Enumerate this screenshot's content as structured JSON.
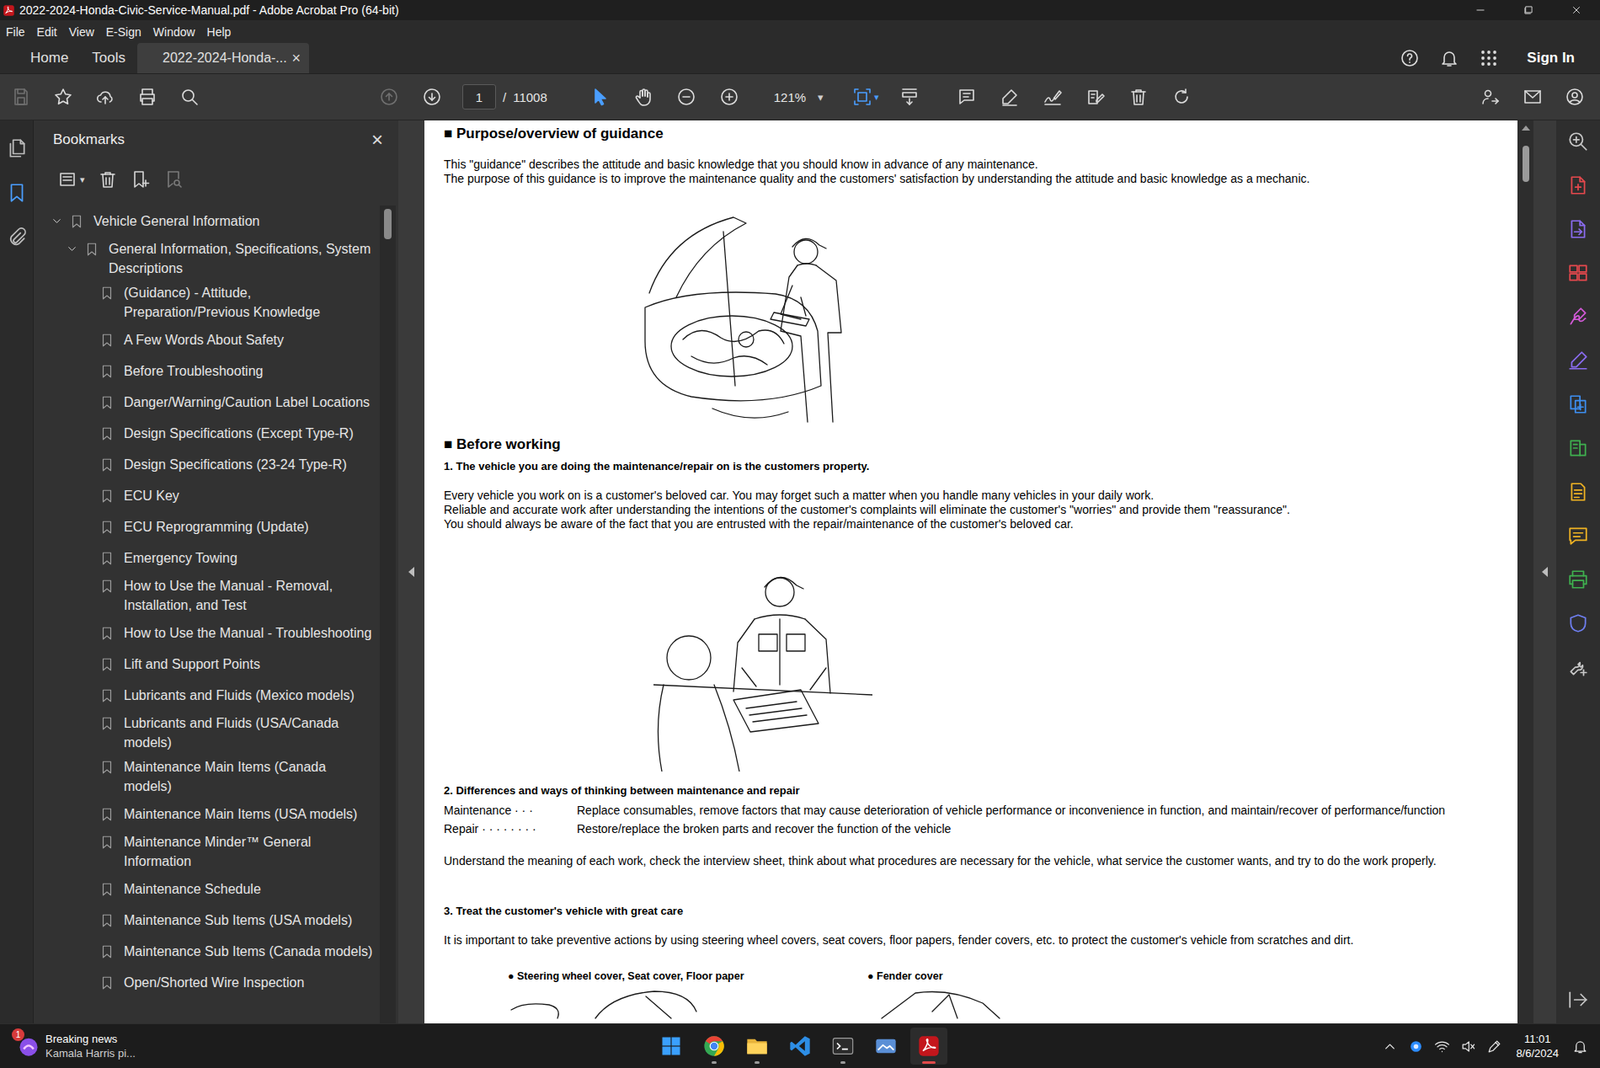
{
  "window": {
    "title": "2022-2024-Honda-Civic-Service-Manual.pdf - Adobe Acrobat Pro (64-bit)",
    "controls": [
      {
        "kind": "minimize"
      },
      {
        "kind": "restore"
      },
      {
        "kind": "close"
      }
    ]
  },
  "menu": [
    "File",
    "Edit",
    "View",
    "E-Sign",
    "Window",
    "Help"
  ],
  "tabs": [
    {
      "label": "Home",
      "selected": false
    },
    {
      "label": "Tools",
      "selected": false
    },
    {
      "label": "2022-2024-Honda-...",
      "selected": true,
      "close": "×"
    }
  ],
  "header_actions": [
    {
      "kind": "help"
    },
    {
      "kind": "bell"
    },
    {
      "kind": "apps"
    }
  ],
  "sign_in": "Sign In",
  "toolbar": {
    "left": [
      {
        "kind": "save",
        "selected": false,
        "disabled": true
      },
      {
        "kind": "star",
        "selected": false,
        "disabled": false
      },
      {
        "kind": "upload",
        "selected": false,
        "disabled": false
      },
      {
        "kind": "print",
        "selected": false,
        "disabled": false
      },
      {
        "kind": "search",
        "selected": false,
        "disabled": false
      }
    ],
    "center": [
      {
        "kind": "prev-page",
        "selected": false,
        "disabled": true
      },
      {
        "kind": "next-page",
        "selected": false,
        "disabled": false
      },
      {
        "kind": "page-field",
        "selected": false,
        "disabled": false,
        "current": "1",
        "separator": "/",
        "total": "11008"
      },
      {
        "kind": "select",
        "selected": true,
        "disabled": false
      },
      {
        "kind": "hand",
        "selected": false,
        "disabled": false
      },
      {
        "kind": "zoom-out",
        "selected": false,
        "disabled": false
      },
      {
        "kind": "zoom-in",
        "selected": false,
        "disabled": false
      },
      {
        "kind": "zoom-field",
        "selected": false,
        "disabled": false,
        "value": "121%",
        "caret": "▾"
      },
      {
        "kind": "fit-page",
        "selected": true,
        "disabled": false,
        "caret": "▾"
      },
      {
        "kind": "scroll-mode",
        "selected": false,
        "disabled": false
      },
      {
        "kind": "comment",
        "selected": false,
        "disabled": false
      },
      {
        "kind": "highlight",
        "selected": false,
        "disabled": false
      },
      {
        "kind": "sign",
        "selected": false,
        "disabled": false
      },
      {
        "kind": "edit",
        "selected": false,
        "disabled": false
      },
      {
        "kind": "delete",
        "selected": false,
        "disabled": false
      },
      {
        "kind": "rotate",
        "selected": false,
        "disabled": false
      }
    ],
    "right": [
      {
        "kind": "share",
        "selected": false,
        "disabled": false
      },
      {
        "kind": "mail",
        "selected": false,
        "disabled": false
      },
      {
        "kind": "account",
        "selected": false,
        "disabled": false
      }
    ]
  },
  "left_rail": [
    {
      "kind": "pages",
      "selected": false
    },
    {
      "kind": "bookmarks",
      "selected": true
    },
    {
      "kind": "attachments",
      "selected": false
    }
  ],
  "bookmarks": {
    "title": "Bookmarks",
    "close": "×",
    "tools": [
      {
        "kind": "options",
        "disabled": false,
        "caret": "▾"
      },
      {
        "kind": "delete",
        "disabled": false
      },
      {
        "kind": "add-bookmark",
        "disabled": false
      },
      {
        "kind": "find-bookmark",
        "disabled": true
      }
    ],
    "items": [
      {
        "label": "Vehicle General Information",
        "depth": 0,
        "kind": "folder",
        "expanded": true
      },
      {
        "label": "General Information, Specifications, System Descriptions",
        "depth": 1,
        "kind": "folder",
        "expanded": true
      },
      {
        "label": "(Guidance) - Attitude, Preparation/Previous Knowledge",
        "depth": 2,
        "kind": "leaf",
        "expanded": false
      },
      {
        "label": "A Few Words About Safety",
        "depth": 2,
        "kind": "leaf",
        "expanded": false
      },
      {
        "label": "Before Troubleshooting",
        "depth": 2,
        "kind": "leaf",
        "expanded": false
      },
      {
        "label": "Danger/Warning/Caution Label Locations",
        "depth": 2,
        "kind": "leaf",
        "expanded": false
      },
      {
        "label": "Design Specifications (Except Type-R)",
        "depth": 2,
        "kind": "leaf",
        "expanded": false
      },
      {
        "label": "Design Specifications (23-24 Type-R)",
        "depth": 2,
        "kind": "leaf",
        "expanded": false
      },
      {
        "label": "ECU Key",
        "depth": 2,
        "kind": "leaf",
        "expanded": false
      },
      {
        "label": "ECU Reprogramming (Update)",
        "depth": 2,
        "kind": "leaf",
        "expanded": false
      },
      {
        "label": "Emergency Towing",
        "depth": 2,
        "kind": "leaf",
        "expanded": false
      },
      {
        "label": "How to Use the Manual - Removal, Installation, and Test",
        "depth": 2,
        "kind": "leaf",
        "expanded": false
      },
      {
        "label": "How to Use the Manual - Troubleshooting",
        "depth": 2,
        "kind": "leaf",
        "expanded": false
      },
      {
        "label": "Lift and Support Points",
        "depth": 2,
        "kind": "leaf",
        "expanded": false
      },
      {
        "label": "Lubricants and Fluids (Mexico models)",
        "depth": 2,
        "kind": "leaf",
        "expanded": false
      },
      {
        "label": "Lubricants and Fluids (USA/Canada models)",
        "depth": 2,
        "kind": "leaf",
        "expanded": false
      },
      {
        "label": "Maintenance Main Items (Canada models)",
        "depth": 2,
        "kind": "leaf",
        "expanded": false
      },
      {
        "label": "Maintenance Main Items (USA models)",
        "depth": 2,
        "kind": "leaf",
        "expanded": false
      },
      {
        "label": "Maintenance Minder™ General Information",
        "depth": 2,
        "kind": "leaf",
        "expanded": false
      },
      {
        "label": "Maintenance Schedule",
        "depth": 2,
        "kind": "leaf",
        "expanded": false
      },
      {
        "label": "Maintenance Sub Items (USA models)",
        "depth": 2,
        "kind": "leaf",
        "expanded": false
      },
      {
        "label": "Maintenance Sub Items (Canada models)",
        "depth": 2,
        "kind": "leaf",
        "expanded": false
      },
      {
        "label": "Open/Shorted Wire Inspection",
        "depth": 2,
        "kind": "leaf",
        "expanded": false
      }
    ]
  },
  "document": {
    "blocks": [
      {
        "kind": "heading",
        "text": "■ Purpose/overview of guidance"
      },
      {
        "kind": "text",
        "lines": [
          "This \"guidance\" describes the attitude and basic knowledge that you should know in advance of any maintenance.",
          "The purpose of this guidance is to improve the maintenance quality and the customers' satisfaction by understanding the attitude and basic knowledge as a mechanic."
        ]
      },
      {
        "kind": "figure",
        "figure": "inspection"
      },
      {
        "kind": "heading",
        "text": "■ Before working"
      },
      {
        "kind": "bold",
        "text": "1. The vehicle you are doing the maintenance/repair on is the customers property."
      },
      {
        "kind": "text",
        "lines": [
          "Every vehicle you work on is a customer's beloved car. You may forget such a matter when you handle many vehicles in your daily work.",
          "Reliable and accurate work after understanding the intentions of the customer's complaints will eliminate the customer's \"worries\" and provide them \"reassurance\".",
          "You should always be aware of the fact that you are entrusted with the repair/maintenance of the customer's beloved car."
        ]
      },
      {
        "kind": "figure",
        "figure": "reception"
      },
      {
        "kind": "bold",
        "text": "2. Differences and ways of thinking between maintenance and repair"
      },
      {
        "kind": "definitions",
        "rows": [
          {
            "term": "Maintenance · · ·",
            "text": "Replace consumables, remove factors that may cause deterioration of vehicle performance or inconvenience in function, and maintain/recover of performance/function"
          },
          {
            "term": "Repair · · · · · · · ·",
            "text": "Restore/replace the broken parts and recover the function of the vehicle"
          }
        ]
      },
      {
        "kind": "text",
        "lines": [
          "Understand the meaning of each work, check the interview sheet, think about what procedures are necessary for the vehicle, what service the customer wants, and try to do the work properly."
        ]
      },
      {
        "kind": "bold",
        "text": "3. Treat the customer's vehicle with great care"
      },
      {
        "kind": "text",
        "lines": [
          "It is important to take preventive actions by using steering wheel covers, seat covers, floor papers, fender covers, etc. to protect the customer's vehicle from scratches and dirt."
        ]
      },
      {
        "kind": "captions",
        "items": [
          "● Steering wheel cover, Seat cover, Floor paper",
          "● Fender cover"
        ]
      },
      {
        "kind": "figure",
        "figure": "covers"
      }
    ]
  },
  "right_rail": {
    "tools": [
      {
        "kind": "zoom-tool",
        "color": "#c8c8c8"
      },
      {
        "kind": "create-pdf",
        "color": "#e5484d"
      },
      {
        "kind": "export-pdf",
        "color": "#8b6cf0"
      },
      {
        "kind": "organize-pages",
        "color": "#e5484d"
      },
      {
        "kind": "request-signature",
        "color": "#d45ad9"
      },
      {
        "kind": "fill-sign",
        "color": "#8b6cf0"
      },
      {
        "kind": "combine",
        "color": "#3d8ef0"
      },
      {
        "kind": "scan",
        "color": "#3fb04f"
      },
      {
        "kind": "prepare-form",
        "color": "#f0b323"
      },
      {
        "kind": "comment-tool",
        "color": "#f0b323"
      },
      {
        "kind": "print-production",
        "color": "#3fb04f"
      },
      {
        "kind": "protect",
        "color": "#6f7ff0"
      },
      {
        "kind": "more-tools",
        "color": "#c8c8c8"
      }
    ],
    "footer": {
      "kind": "hide-panel"
    }
  },
  "taskbar": {
    "widget": {
      "badge": "1",
      "title": "Breaking news",
      "subtitle": "Kamala Harris pi..."
    },
    "apps": [
      {
        "kind": "start",
        "running": false,
        "active": false
      },
      {
        "kind": "chrome",
        "running": true,
        "active": false
      },
      {
        "kind": "explorer",
        "running": true,
        "active": false
      },
      {
        "kind": "vscode",
        "running": false,
        "active": false
      },
      {
        "kind": "terminal",
        "running": true,
        "active": false
      },
      {
        "kind": "monitor",
        "running": false,
        "active": false
      },
      {
        "kind": "acrobat",
        "running": true,
        "active": true
      }
    ],
    "tray": [
      {
        "kind": "chevron-up"
      },
      {
        "kind": "copilot"
      },
      {
        "kind": "wifi"
      },
      {
        "kind": "volume-muted"
      },
      {
        "kind": "pen"
      }
    ],
    "clock": {
      "time": "11:01",
      "date": "8/6/2024"
    },
    "notifications": {
      "kind": "bell"
    }
  }
}
